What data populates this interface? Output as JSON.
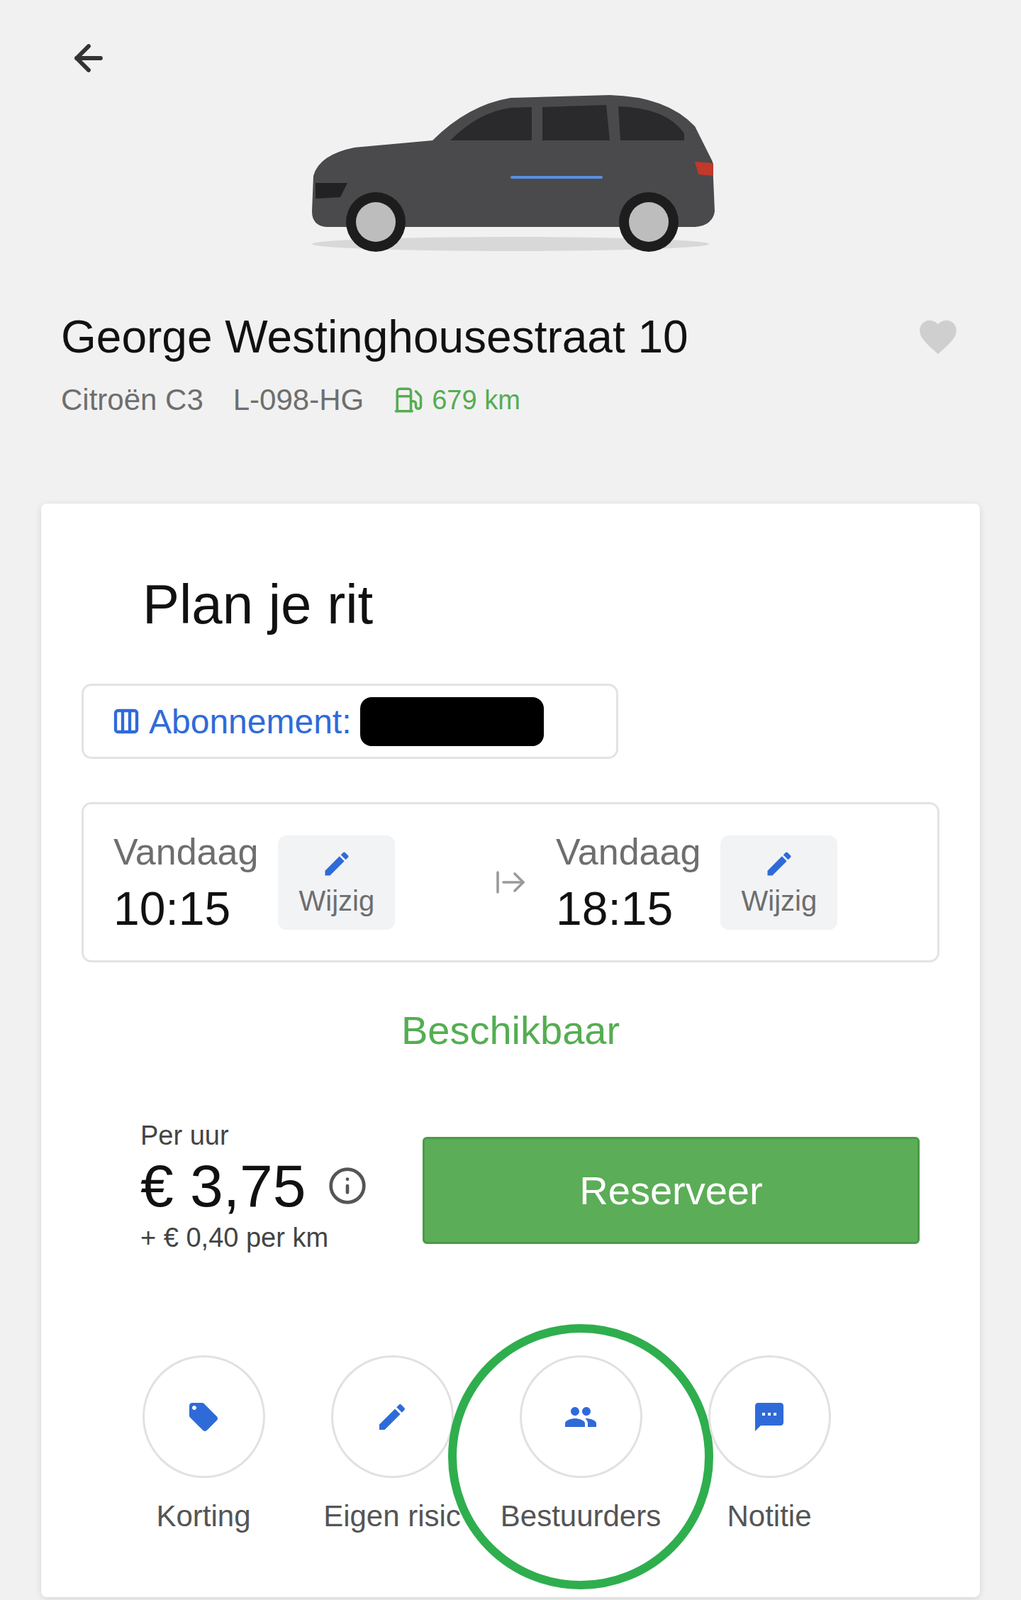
{
  "location": {
    "title": "George Westinghousestraat 10",
    "favorite": false,
    "model": "Citroën C3",
    "plate": "L-098-HG",
    "range": "679 km"
  },
  "plan": {
    "title": "Plan je rit",
    "subscription": {
      "label": "Abonnement:",
      "redacted": true
    },
    "start": {
      "day": "Vandaag",
      "time": "10:15",
      "edit": "Wijzig"
    },
    "end": {
      "day": "Vandaag",
      "time": "18:15",
      "edit": "Wijzig"
    },
    "status": "Beschikbaar"
  },
  "price": {
    "label": "Per uur",
    "amount": "€ 3,75",
    "extra": "+ € 0,40 per km"
  },
  "reserve_button": "Reserveer",
  "actions": [
    {
      "label": "Korting",
      "highlighted": false
    },
    {
      "label": "Eigen risic",
      "highlighted": false
    },
    {
      "label": "Bestuurders",
      "highlighted": true
    },
    {
      "label": "Notitie",
      "highlighted": false
    }
  ]
}
